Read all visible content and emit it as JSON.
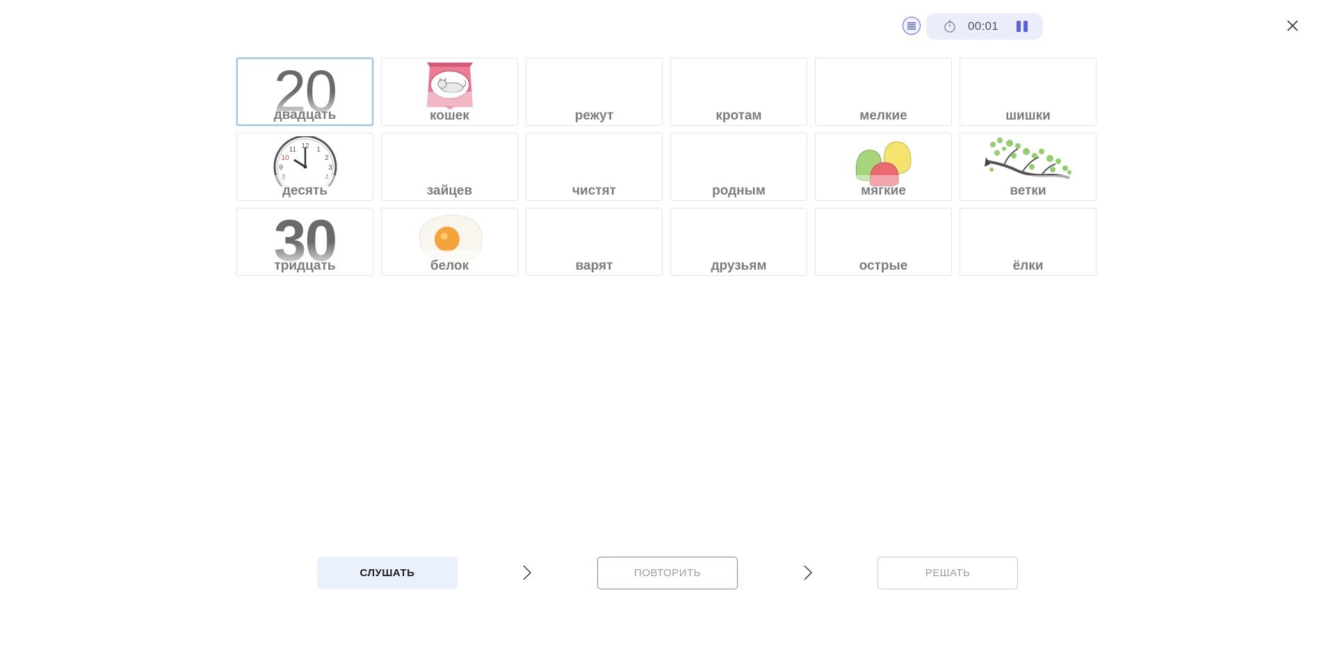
{
  "timer": {
    "time": "00:01"
  },
  "cards": [
    {
      "word": "двадцать",
      "image": "number-20",
      "number": "20",
      "selected": true
    },
    {
      "word": "кошек",
      "image": "cat-food-bag"
    },
    {
      "word": "режут"
    },
    {
      "word": "кротам"
    },
    {
      "word": "мелкие"
    },
    {
      "word": "шишки"
    },
    {
      "word": "десять",
      "image": "clock-10"
    },
    {
      "word": "зайцев"
    },
    {
      "word": "чистят"
    },
    {
      "word": "родным"
    },
    {
      "word": "мягкие",
      "image": "gummy-candies"
    },
    {
      "word": "ветки",
      "image": "tree-branch"
    },
    {
      "word": "тридцать",
      "image": "number-30",
      "number": "30"
    },
    {
      "word": "белок",
      "image": "fried-egg"
    },
    {
      "word": "варят"
    },
    {
      "word": "друзьям"
    },
    {
      "word": "острые"
    },
    {
      "word": "ёлки"
    }
  ],
  "clock": {
    "n12": "12",
    "n11": "11",
    "n10": "10",
    "n9": "9",
    "n8": "8",
    "n1": "1",
    "n2": "2",
    "n3": "3",
    "n4": "4"
  },
  "buttons": {
    "listen": "СЛУШАТЬ",
    "repeat": "ПОВТОРИТЬ",
    "solve": "РЕШАТЬ"
  },
  "colors": {
    "accent": "#5a63d8",
    "pill": "#ecedfb",
    "listen_bg": "#eaf1fd",
    "repeat_border": "#8a78e0",
    "selected_border": "#9fc6ea"
  }
}
